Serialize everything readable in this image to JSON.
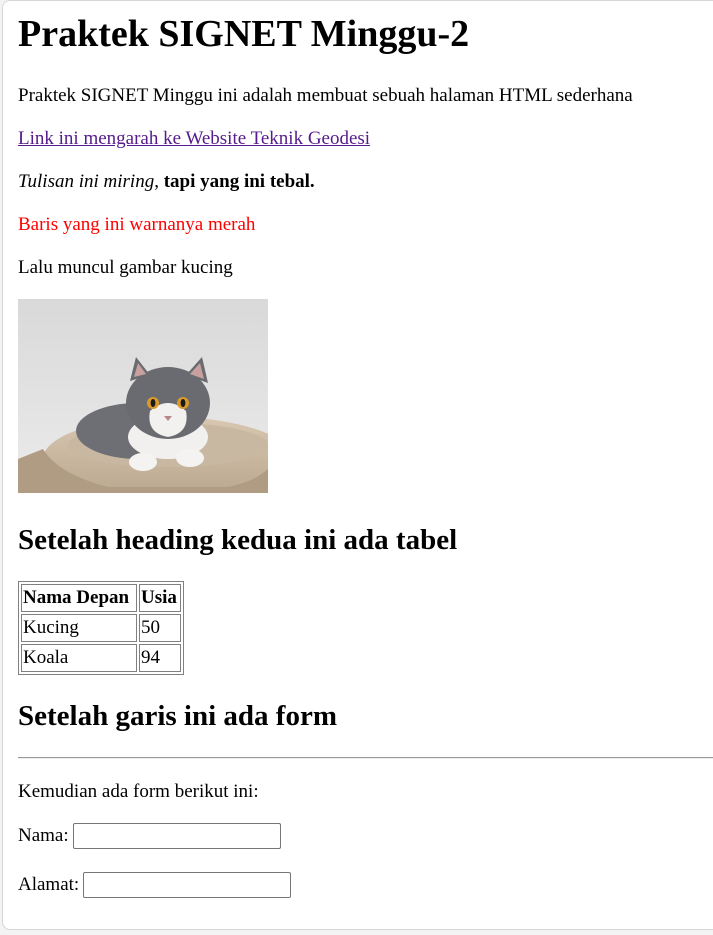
{
  "heading1": "Praktek SIGNET Minggu-2",
  "intro": "Praktek SIGNET Minggu ini adalah membuat sebuah halaman HTML sederhana",
  "link_text": "Link ini mengarah ke Website Teknik Geodesi",
  "italic_text": "Tulisan ini miring",
  "comma": ",",
  "bold_text": "tapi yang ini tebal.",
  "red_text": "Baris yang ini warnanya merah",
  "image_caption": "Lalu muncul gambar kucing",
  "heading2_table": "Setelah heading kedua ini ada tabel",
  "table": {
    "headers": [
      "Nama Depan",
      "Usia"
    ],
    "rows": [
      [
        "Kucing",
        "50"
      ],
      [
        "Koala",
        "94"
      ]
    ]
  },
  "heading2_form": "Setelah garis ini ada form",
  "form_intro": "Kemudian ada form berikut ini:",
  "form": {
    "nama_label": "Nama:",
    "nama_value": "",
    "alamat_label": "Alamat:",
    "alamat_value": ""
  },
  "colors": {
    "link": "#551a8b",
    "red": "#ff0000"
  }
}
